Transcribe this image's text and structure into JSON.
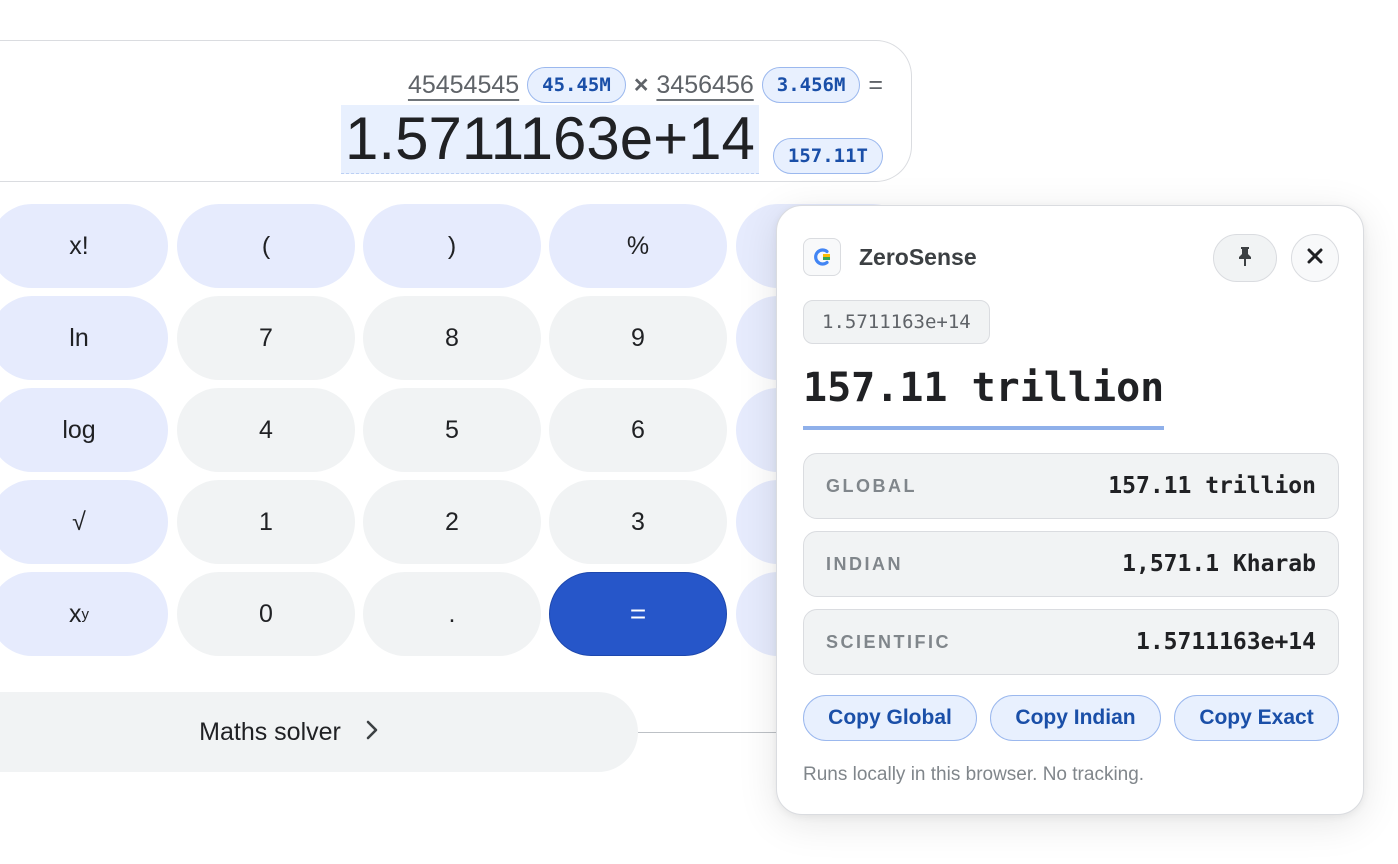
{
  "display": {
    "operand1": "45454545",
    "operand1_chip": "45.45M",
    "operator": "×",
    "operand2": "3456456",
    "operand2_chip": "3.456M",
    "equals": "=",
    "result": "1.5711163e+14",
    "result_chip": "157.11T"
  },
  "keypad": {
    "rows": [
      [
        "x!",
        "(",
        ")",
        "%"
      ],
      [
        "ln",
        "7",
        "8",
        "9"
      ],
      [
        "log",
        "4",
        "5",
        "6"
      ],
      [
        "√",
        "1",
        "2",
        "3"
      ],
      [
        "x",
        "0",
        ".",
        "="
      ]
    ],
    "power_sup": "y"
  },
  "solver": {
    "label": "Maths solver",
    "chevron": "›"
  },
  "panel": {
    "brand": "ZeroSense",
    "input_value": "1.5711163e+14",
    "headline": "157.11 trillion",
    "rows": [
      {
        "label": "GLOBAL",
        "value": "157.11 trillion"
      },
      {
        "label": "INDIAN",
        "value": "1,571.1 Kharab"
      },
      {
        "label": "SCIENTIFIC",
        "value": "1.5711163e+14"
      }
    ],
    "copy_global": "Copy Global",
    "copy_indian": "Copy Indian",
    "copy_exact": "Copy Exact",
    "footnote": "Runs locally in this browser. No tracking.",
    "colors": {
      "accent": "#1a4fa8",
      "equals_key": "#2656c9",
      "underline": "#8fb0ea"
    }
  }
}
